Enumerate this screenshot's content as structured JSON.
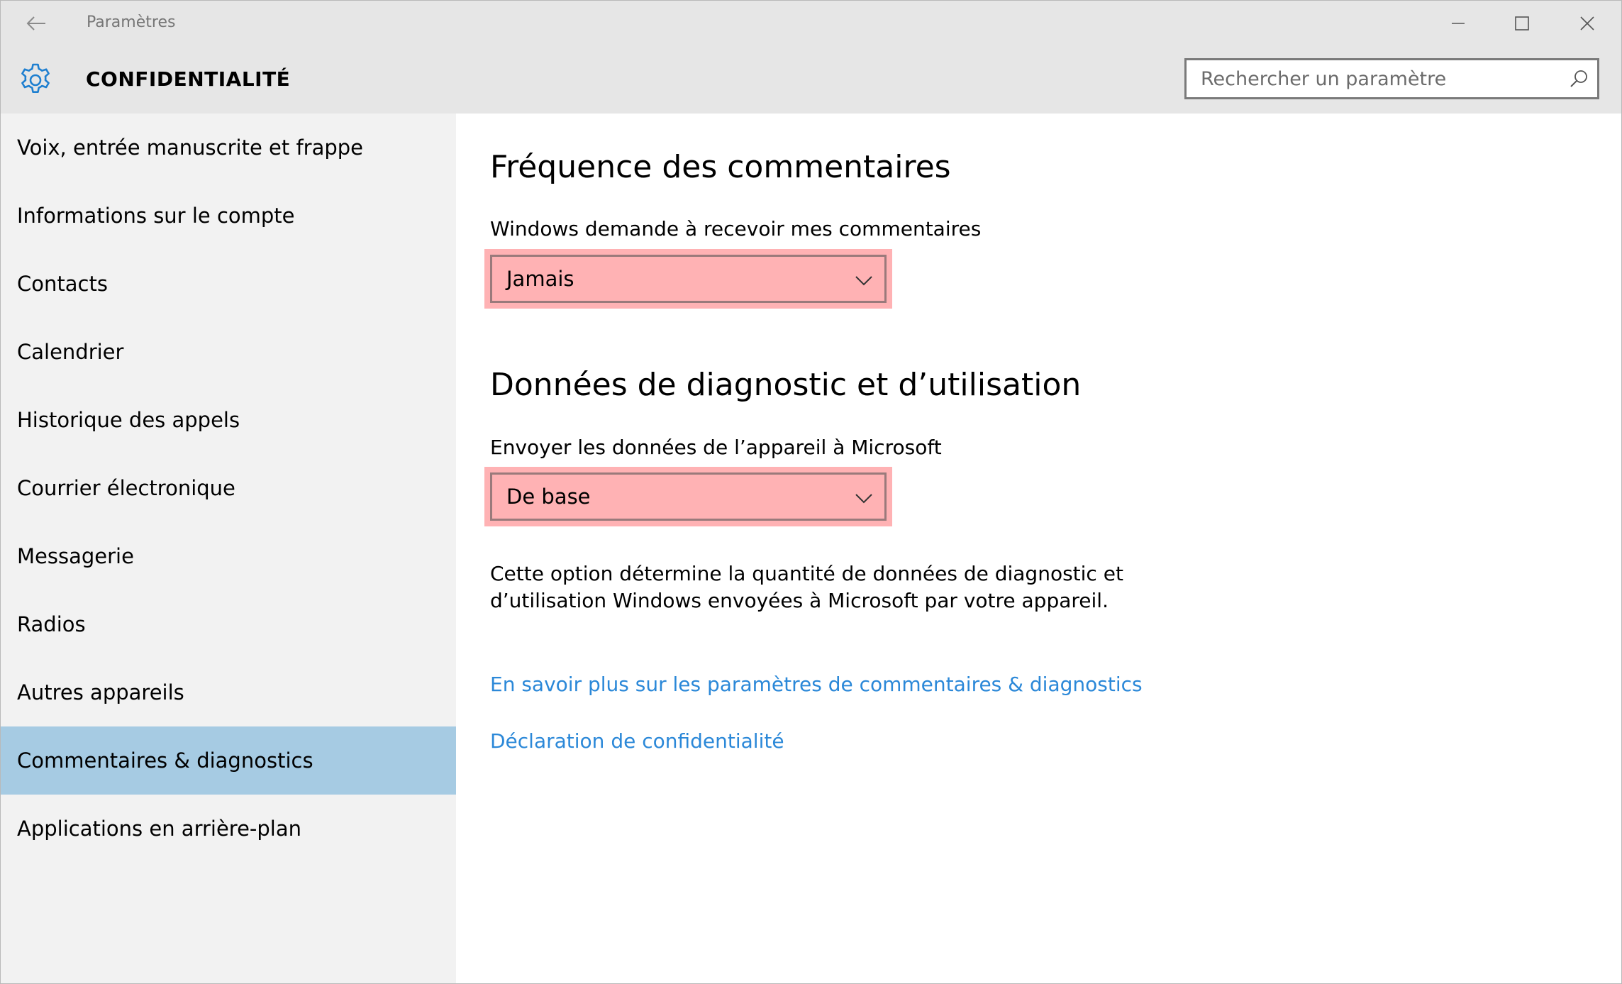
{
  "window": {
    "title": "Paramètres",
    "controls": [
      "minimize",
      "maximize",
      "close"
    ]
  },
  "header": {
    "icon": "gear-icon",
    "title": "CONFIDENTIALITÉ",
    "search_placeholder": "Rechercher un paramètre"
  },
  "sidebar": {
    "items": [
      {
        "label": "Voix, entrée manuscrite et frappe",
        "active": false
      },
      {
        "label": "Informations sur le compte",
        "active": false
      },
      {
        "label": "Contacts",
        "active": false
      },
      {
        "label": "Calendrier",
        "active": false
      },
      {
        "label": "Historique des appels",
        "active": false
      },
      {
        "label": "Courrier électronique",
        "active": false
      },
      {
        "label": "Messagerie",
        "active": false
      },
      {
        "label": "Radios",
        "active": false
      },
      {
        "label": "Autres appareils",
        "active": false
      },
      {
        "label": "Commentaires & diagnostics",
        "active": true
      },
      {
        "label": "Applications en arrière-plan",
        "active": false
      }
    ]
  },
  "main": {
    "feedback": {
      "heading": "Fréquence des commentaires",
      "label": "Windows demande à recevoir mes commentaires",
      "value": "Jamais"
    },
    "diagnostics": {
      "heading": "Données de diagnostic et d’utilisation",
      "label": "Envoyer les données de l’appareil à Microsoft",
      "value": "De base",
      "description": "Cette option détermine la quantité de données de diagnostic et d’utilisation Windows envoyées à Microsoft par votre appareil."
    },
    "links": {
      "learn_more": "En savoir plus sur les paramètres de commentaires & diagnostics",
      "privacy": "Déclaration de confidentialité"
    }
  },
  "colors": {
    "titlebar_bg": "#e6e6e6",
    "sidebar_bg": "#f2f2f2",
    "active_item_bg": "#a6cbe3",
    "accent": "#2b88d8",
    "highlight": "#ffb2b4"
  }
}
